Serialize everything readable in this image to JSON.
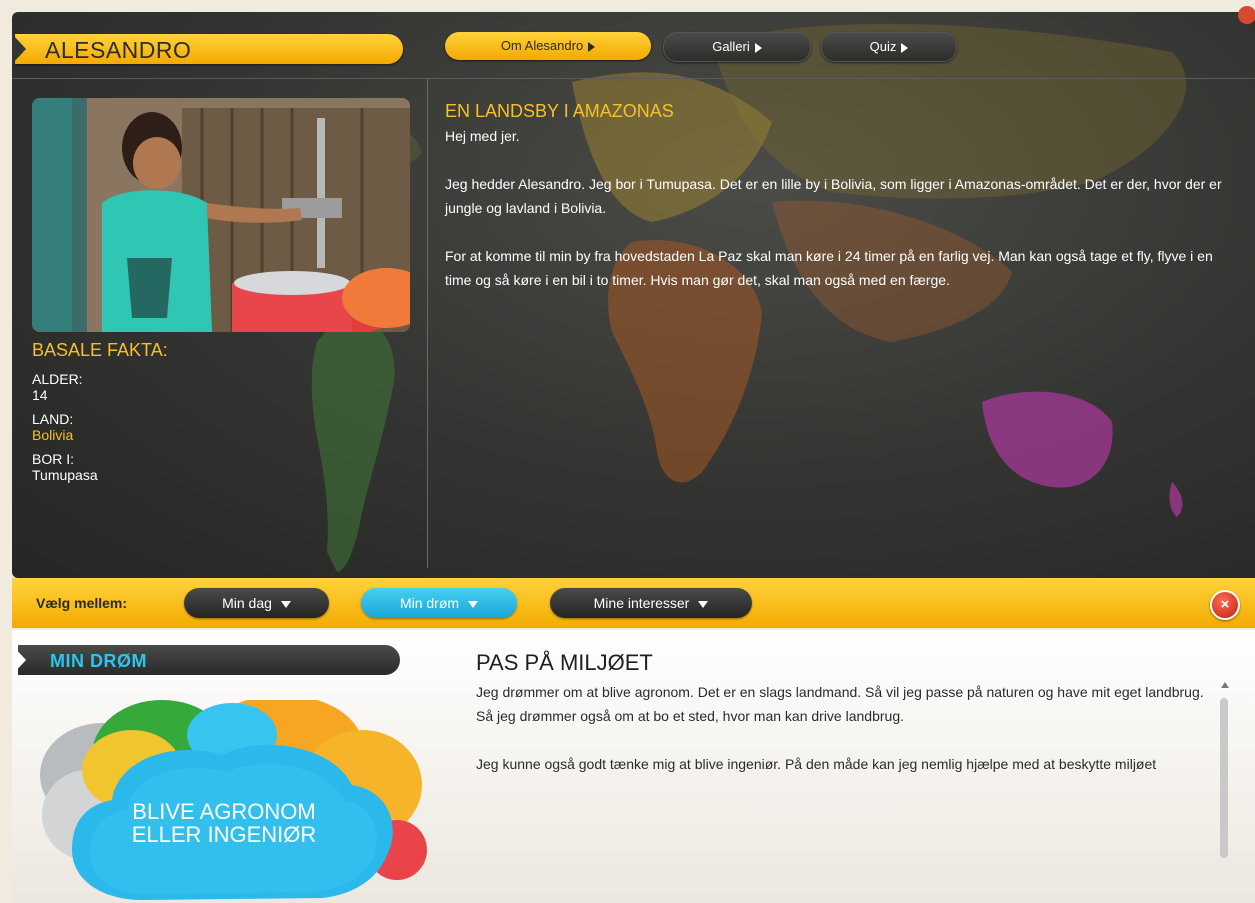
{
  "header": {
    "name": "ALESANDRO",
    "tabs": [
      {
        "label": "Om Alesandro",
        "active": true
      },
      {
        "label": "Galleri",
        "active": false
      },
      {
        "label": "Quiz",
        "active": false
      }
    ]
  },
  "facts": {
    "heading": "BASALE FAKTA:",
    "age_label": "ALDER:",
    "age_value": "14",
    "country_label": "LAND:",
    "country_value": "Bolivia",
    "lives_label": "BOR I:",
    "lives_value": "Tumupasa"
  },
  "story": {
    "title": "EN LANDSBY I AMAZONAS",
    "p1": "Hej med jer.",
    "p2": "Jeg hedder Alesandro. Jeg bor i Tumupasa. Det er en lille by i Bolivia, som ligger i Amazonas-området. Det er der, hvor der er jungle og lavland i Bolivia.",
    "p3": "For at komme til min by fra hovedstaden La Paz skal man køre i 24 timer på en farlig vej. Man kan også tage et fly, flyve i en time og så køre i en bil i to timer. Hvis man gør det, skal man også med en færge."
  },
  "selector": {
    "label": "Vælg mellem:",
    "options": [
      {
        "label": "Min dag",
        "active": false
      },
      {
        "label": "Min drøm",
        "active": true
      },
      {
        "label": "Mine interesser",
        "active": false
      }
    ]
  },
  "dream": {
    "section_title": "MIN DRØM",
    "cloud_line1": "BLIVE AGRONOM",
    "cloud_line2": "ELLER INGENIØR",
    "title": "PAS PÅ MILJØET",
    "p1": "Jeg drømmer om at blive agronom. Det er en slags landmand. Så vil jeg passe på naturen og have mit eget landbrug. Så jeg drømmer også om at bo et sted, hvor man kan drive landbrug.",
    "p2": "Jeg kunne også godt tænke mig at blive ingeniør. På den måde kan jeg nemlig hjælpe med at beskytte miljøet"
  },
  "colors": {
    "accent_yellow": "#f6c026",
    "accent_cyan": "#2fc4ee",
    "close_red": "#c0210e"
  }
}
